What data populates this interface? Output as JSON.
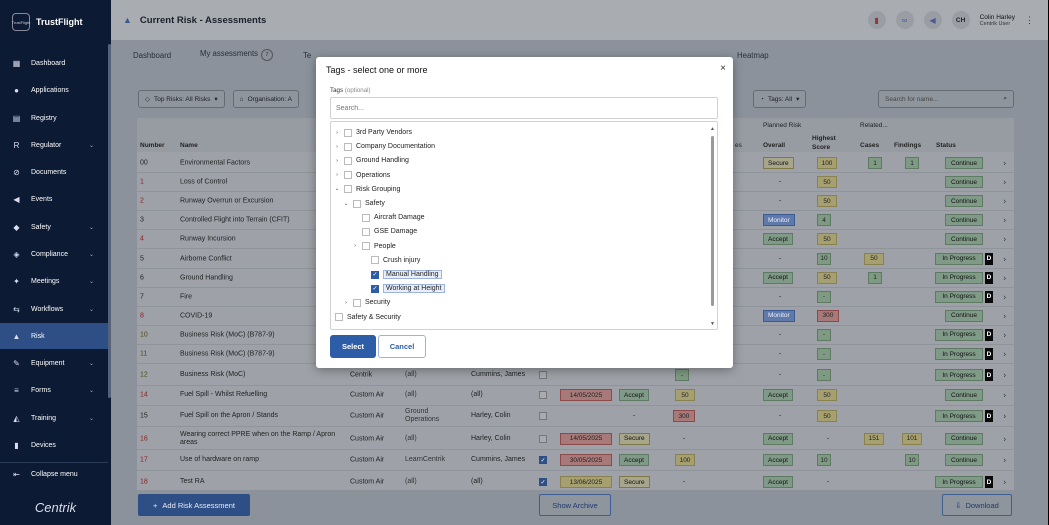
{
  "app": {
    "brand": "TrustFlight",
    "logo_text": "TrustFlight",
    "footer_brand": "Centrik"
  },
  "sidebar": {
    "items": [
      {
        "label": "Dashboard",
        "icon": "dashboard-icon",
        "glyph": "▦",
        "chevron": false,
        "active": false
      },
      {
        "label": "Applications",
        "icon": "person-icon",
        "glyph": "●",
        "chevron": false,
        "active": false
      },
      {
        "label": "Registry",
        "icon": "book-icon",
        "glyph": "▤",
        "chevron": false,
        "active": false
      },
      {
        "label": "Regulator",
        "icon": "regulator-icon",
        "glyph": "R",
        "chevron": true,
        "active": false
      },
      {
        "label": "Documents",
        "icon": "paperclip-icon",
        "glyph": "⊘",
        "chevron": false,
        "active": false
      },
      {
        "label": "Events",
        "icon": "megaphone-icon",
        "glyph": "◀",
        "chevron": false,
        "active": false
      },
      {
        "label": "Safety",
        "icon": "shield-icon",
        "glyph": "◆",
        "chevron": true,
        "active": false
      },
      {
        "label": "Compliance",
        "icon": "check-shield-icon",
        "glyph": "◈",
        "chevron": true,
        "active": false
      },
      {
        "label": "Meetings",
        "icon": "meeting-icon",
        "glyph": "✦",
        "chevron": true,
        "active": false
      },
      {
        "label": "Workflows",
        "icon": "workflow-icon",
        "glyph": "⇆",
        "chevron": true,
        "active": false
      },
      {
        "label": "Risk",
        "icon": "risk-icon",
        "glyph": "▲",
        "chevron": false,
        "active": true
      },
      {
        "label": "Equipment",
        "icon": "wrench-icon",
        "glyph": "✎",
        "chevron": true,
        "active": false
      },
      {
        "label": "Forms",
        "icon": "forms-icon",
        "glyph": "≡",
        "chevron": true,
        "active": false
      },
      {
        "label": "Training",
        "icon": "graduation-icon",
        "glyph": "◭",
        "chevron": true,
        "active": false
      },
      {
        "label": "Devices",
        "icon": "device-icon",
        "glyph": "▮",
        "chevron": false,
        "active": false
      }
    ],
    "collapse_label": "Collapse menu"
  },
  "header": {
    "title": "Current Risk - Assessments",
    "user_initials": "CH",
    "user_name": "Colin Harley",
    "user_role": "Centrik User"
  },
  "tabs": [
    {
      "label": "Dashboard",
      "badge": ""
    },
    {
      "label": "My assessments",
      "badge": "7"
    },
    {
      "label": "Te",
      "badge": ""
    },
    {
      "label": "Heatmap",
      "badge": ""
    }
  ],
  "filters": {
    "top_risks": "Top Risks: All Risks",
    "organisation": "Organisation: A",
    "tags": "Tags: All",
    "search_placeholder": "Search for name..."
  },
  "table": {
    "headers": {
      "number": "Number",
      "name": "Name",
      "planned_risk": "Planned Risk",
      "related": "Related...",
      "overall": "Overall",
      "highest_score": "Highest Score",
      "cases": "Cases",
      "findings": "Findings",
      "status": "Status",
      "es": "es"
    },
    "rows": [
      {
        "num": "00",
        "name": "Environmental Factors",
        "red": false,
        "olive": false,
        "overall": "Secure",
        "ov": "secure",
        "score": "100",
        "sc": "score-y",
        "cases": "1",
        "findings": "1",
        "status": "Continue",
        "st": "continue",
        "d": false
      },
      {
        "num": "1",
        "name": "Loss of Control",
        "red": true,
        "olive": false,
        "overall": "-",
        "ov": "",
        "score": "50",
        "sc": "score-y",
        "cases": "",
        "findings": "",
        "status": "Continue",
        "st": "continue",
        "d": false
      },
      {
        "num": "2",
        "name": "Runway Overrun or Excursion",
        "red": true,
        "olive": false,
        "overall": "-",
        "ov": "",
        "score": "50",
        "sc": "score-y",
        "cases": "",
        "findings": "",
        "status": "Continue",
        "st": "continue",
        "d": false
      },
      {
        "num": "3",
        "name": "Controlled Flight into Terrain (CFIT)",
        "red": false,
        "olive": false,
        "overall": "Monitor",
        "ov": "monitor",
        "score": "4",
        "sc": "score-g",
        "cases": "",
        "findings": "",
        "status": "Continue",
        "st": "continue",
        "d": false
      },
      {
        "num": "4",
        "name": "Runway Incursion",
        "red": true,
        "olive": false,
        "overall": "Accept",
        "ov": "accept",
        "score": "50",
        "sc": "score-y",
        "cases": "",
        "findings": "",
        "status": "Continue",
        "st": "continue",
        "d": false
      },
      {
        "num": "5",
        "name": "Airborne Conflict",
        "red": false,
        "olive": false,
        "overall": "-",
        "ov": "",
        "score": "10",
        "sc": "score-g",
        "cases": "50",
        "findings": "",
        "status": "In Progress",
        "st": "inprog",
        "d": true
      },
      {
        "num": "6",
        "name": "Ground Handling",
        "red": false,
        "olive": false,
        "overall": "Accept",
        "ov": "accept",
        "score": "50",
        "sc": "score-y",
        "cases": "1",
        "findings": "",
        "status": "In Progress",
        "st": "inprog",
        "d": true
      },
      {
        "num": "7",
        "name": "Fire",
        "red": false,
        "olive": false,
        "overall": "-",
        "ov": "",
        "score": "-",
        "sc": "score-g",
        "cases": "",
        "findings": "",
        "status": "In Progress",
        "st": "inprog",
        "d": true
      },
      {
        "num": "8",
        "name": "COVID-19",
        "red": true,
        "olive": false,
        "overall": "Monitor",
        "ov": "monitor",
        "score": "300",
        "sc": "score-r",
        "cases": "",
        "findings": "",
        "status": "Continue",
        "st": "continue",
        "d": false
      },
      {
        "num": "10",
        "name": "Business Risk (MoC) (B787-9)",
        "red": false,
        "olive": true,
        "overall": "-",
        "ov": "",
        "score": "-",
        "sc": "score-g",
        "cases": "",
        "findings": "",
        "status": "In Progress",
        "st": "inprog",
        "d": true
      },
      {
        "num": "11",
        "name": "Business Risk (MoC) (B787-9)",
        "red": false,
        "olive": true,
        "overall": "-",
        "ov": "",
        "score": "-",
        "sc": "score-g",
        "cases": "",
        "findings": "",
        "status": "In Progress",
        "st": "inprog",
        "d": true
      }
    ],
    "rows2": [
      {
        "num": "12",
        "name": "Business Risk (MoC)",
        "red": false,
        "olive": true,
        "org": "Centrik",
        "dept": "(all)",
        "owner": "Cummins, James",
        "cb": false,
        "date": "",
        "dt": "",
        "plan": "",
        "pl": "",
        "pscore": "-",
        "ps": "score-g",
        "overall": "-",
        "ov": "",
        "score": "-",
        "sc": "score-g",
        "cases": "",
        "findings": "",
        "status": "In Progress",
        "st": "inprog",
        "d": true
      },
      {
        "num": "14",
        "name": "Fuel Spill - Whilst Refuelling",
        "red": true,
        "olive": false,
        "org": "Custom Air",
        "dept": "(all)",
        "owner": "(all)",
        "cb": false,
        "date": "14/05/2025",
        "dt": "date-r",
        "plan": "Accept",
        "pl": "accept",
        "pscore": "50",
        "ps": "score-y",
        "overall": "Accept",
        "ov": "accept",
        "score": "50",
        "sc": "score-y",
        "cases": "",
        "findings": "",
        "status": "Continue",
        "st": "continue",
        "d": false
      },
      {
        "num": "15",
        "name": "Fuel Spill on the Apron / Stands",
        "red": false,
        "olive": false,
        "org": "Custom Air",
        "dept": "Ground Operations",
        "owner": "Harley, Colin",
        "cb": false,
        "date": "",
        "dt": "",
        "plan": "-",
        "pl": "",
        "pscore": "300",
        "ps": "score-r",
        "overall": "-",
        "ov": "",
        "score": "50",
        "sc": "score-y",
        "cases": "",
        "findings": "",
        "status": "In Progress",
        "st": "inprog",
        "d": true
      },
      {
        "num": "16",
        "name": "Wearing correct PPRE when on the Ramp / Apron areas",
        "red": true,
        "olive": false,
        "org": "Custom Air",
        "dept": "(all)",
        "owner": "Harley, Colin",
        "cb": false,
        "date": "14/05/2025",
        "dt": "date-r",
        "plan": "Secure",
        "pl": "secure",
        "pscore": "-",
        "ps": "",
        "overall": "Accept",
        "ov": "accept",
        "score": "-",
        "sc": "",
        "cases": "151",
        "findings": "101",
        "status": "Continue",
        "st": "continue",
        "d": false
      },
      {
        "num": "17",
        "name": "Use of hardware on ramp",
        "red": true,
        "olive": false,
        "org": "Custom Air",
        "dept": "LearnCentrik",
        "owner": "Cummins, James",
        "cb": true,
        "date": "30/05/2025",
        "dt": "date-r",
        "plan": "Accept",
        "pl": "accept",
        "pscore": "100",
        "ps": "score-y",
        "overall": "Accept",
        "ov": "accept",
        "score": "10",
        "sc": "score-g",
        "cases": "",
        "findings": "10",
        "status": "Continue",
        "st": "continue",
        "d": false
      },
      {
        "num": "18",
        "name": "Test RA",
        "red": true,
        "olive": false,
        "org": "Custom Air",
        "dept": "(all)",
        "owner": "(all)",
        "cb": true,
        "date": "13/06/2025",
        "dt": "date-y",
        "plan": "Secure",
        "pl": "secure",
        "pscore": "-",
        "ps": "",
        "overall": "Accept",
        "ov": "accept",
        "score": "-",
        "sc": "",
        "cases": "",
        "findings": "",
        "status": "In Progress",
        "st": "inprog",
        "d": true
      }
    ]
  },
  "footer": {
    "add_label": "Add Risk Assessment",
    "archive_label": "Show Archive",
    "download_label": "Download"
  },
  "modal": {
    "title": "Tags - select one or more",
    "close_glyph": "×",
    "field_label": "Tags",
    "field_hint": "(optional)",
    "search_placeholder": "Search...",
    "tree": [
      {
        "label": "3rd Party Vendors",
        "level": 0,
        "exp": "›",
        "checked": false,
        "sel": false
      },
      {
        "label": "Company Documentation",
        "level": 0,
        "exp": "›",
        "checked": false,
        "sel": false
      },
      {
        "label": "Ground Handling",
        "level": 0,
        "exp": "›",
        "checked": false,
        "sel": false
      },
      {
        "label": "Operations",
        "level": 0,
        "exp": "›",
        "checked": false,
        "sel": false
      },
      {
        "label": "Risk Grouping",
        "level": 0,
        "exp": "⌄",
        "checked": false,
        "sel": false
      },
      {
        "label": "Safety",
        "level": 1,
        "exp": "⌄",
        "checked": false,
        "sel": false
      },
      {
        "label": "Aircraft Damage",
        "level": 2,
        "exp": "",
        "checked": false,
        "sel": false
      },
      {
        "label": "GSE Damage",
        "level": 2,
        "exp": "",
        "checked": false,
        "sel": false
      },
      {
        "label": "People",
        "level": 2,
        "exp": "›",
        "checked": false,
        "sel": false
      },
      {
        "label": "Crush injury",
        "level": 3,
        "exp": "",
        "checked": false,
        "sel": false
      },
      {
        "label": "Manual Handling",
        "level": 3,
        "exp": "",
        "checked": true,
        "sel": true
      },
      {
        "label": "Working at Height",
        "level": 3,
        "exp": "",
        "checked": true,
        "sel": true
      },
      {
        "label": "Security",
        "level": 1,
        "exp": "›",
        "checked": false,
        "sel": false
      },
      {
        "label": "Safety & Security",
        "level": -1,
        "exp": "",
        "checked": false,
        "sel": false
      }
    ],
    "select_label": "Select",
    "cancel_label": "Cancel"
  }
}
